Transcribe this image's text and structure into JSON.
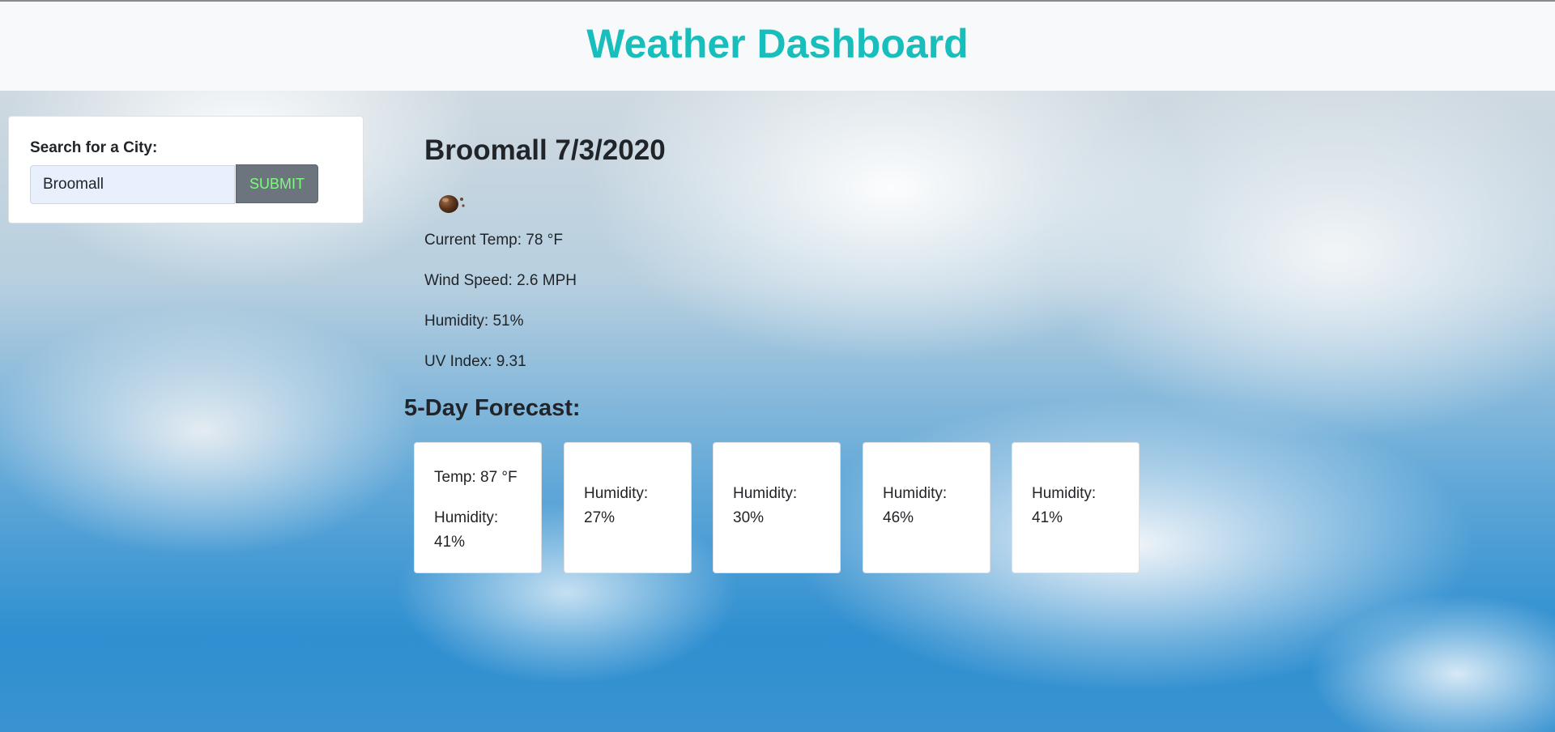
{
  "header": {
    "title": "Weather Dashboard"
  },
  "search": {
    "label": "Search for a City:",
    "value": "Broomall",
    "submit_label": "SUBMIT"
  },
  "current": {
    "heading": "Broomall 7/3/2020",
    "icon": "rain-drop-icon",
    "temp": "Current Temp: 78 °F",
    "wind": "Wind Speed: 2.6 MPH",
    "humidity": "Humidity: 51%",
    "uv": "UV Index: 9.31"
  },
  "forecast": {
    "title": "5-Day Forecast:",
    "cards": [
      {
        "temp": "Temp: 87 °F",
        "humidity": "Humidity: 41%"
      },
      {
        "temp": "",
        "humidity": "Humidity: 27%"
      },
      {
        "temp": "",
        "humidity": "Humidity: 30%"
      },
      {
        "temp": "",
        "humidity": "Humidity: 46%"
      },
      {
        "temp": "",
        "humidity": "Humidity: 41%"
      }
    ]
  },
  "colors": {
    "title_accent": "#17bebb",
    "submit_text": "#7CFC7C",
    "submit_bg": "#6c757d"
  }
}
